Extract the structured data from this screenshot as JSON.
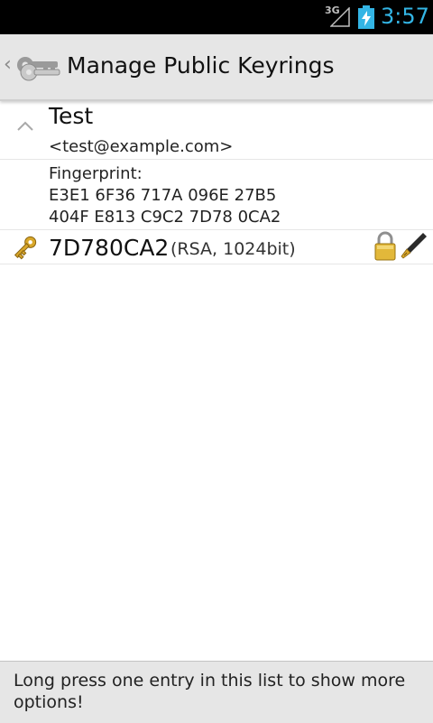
{
  "status_bar": {
    "network": "3G",
    "time": "3:57",
    "time_color": "#33b5e5",
    "icons": [
      "signal-icon",
      "battery-charging-icon"
    ]
  },
  "action_bar": {
    "up_caret": "‹",
    "title": "Manage Public Keyrings",
    "icon": "keyring-app-icon"
  },
  "keyring": {
    "user_name": "Test",
    "user_email": "<test@example.com>",
    "fingerprint_label": "Fingerprint:",
    "fingerprint_line1": "E3E1 6F36 717A 096E 27B5",
    "fingerprint_line2": "404F E813 C9C2 7D78 0CA2",
    "key": {
      "id": "7D780CA2",
      "algorithm": "(RSA, 1024bit)",
      "icons": [
        "key-icon",
        "lock-icon",
        "fountain-pen-icon"
      ]
    }
  },
  "footer_hint": "Long press one entry in this list to show more options!"
}
